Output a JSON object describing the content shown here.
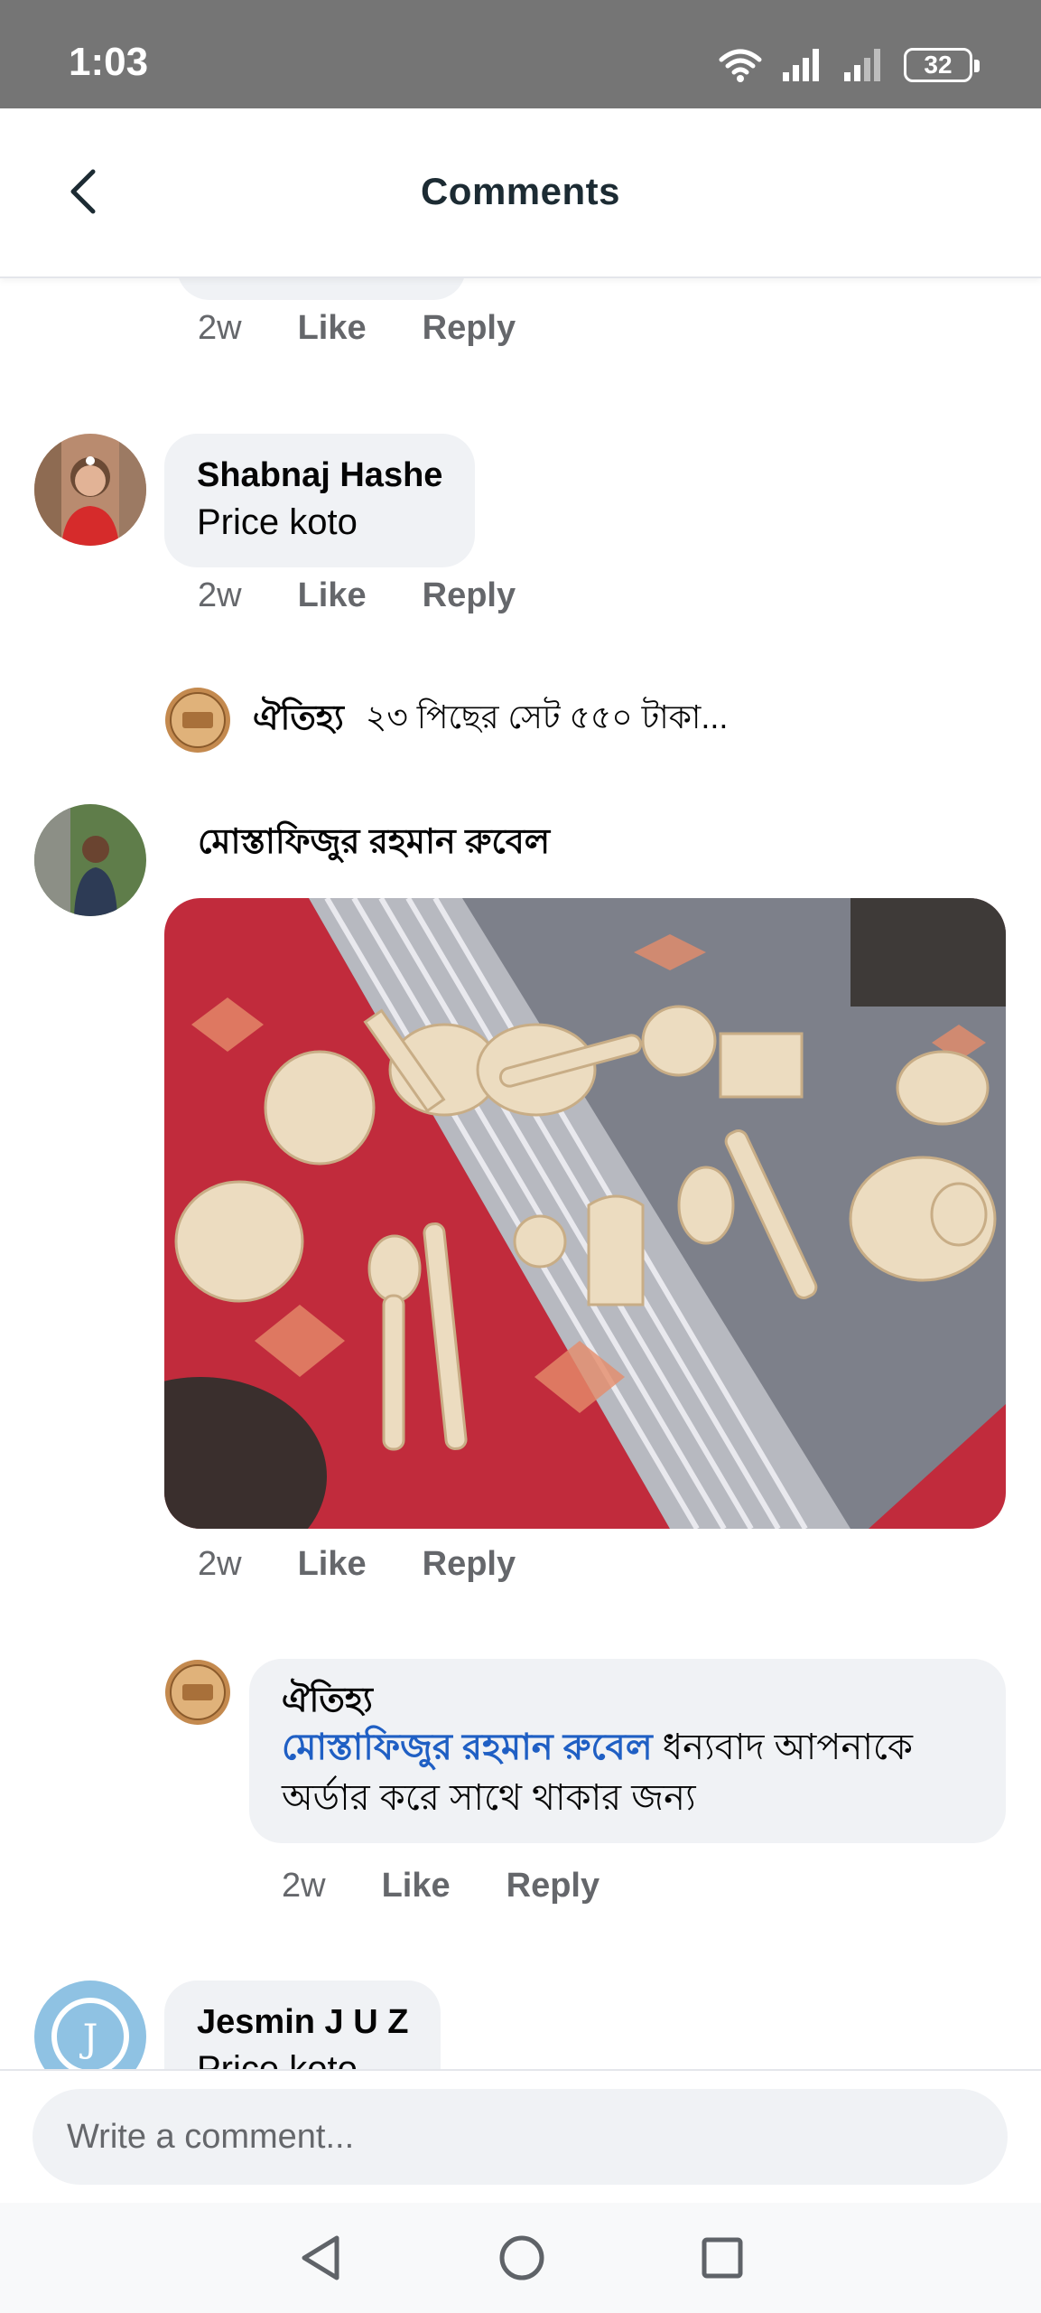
{
  "status_bar": {
    "time": "1:03",
    "battery": "32",
    "icons": [
      "wifi-icon",
      "signal-icon",
      "signal-weak-icon",
      "battery-icon"
    ]
  },
  "header": {
    "title": "Comments",
    "back_icon": "chevron-left-icon"
  },
  "comments": [
    {
      "author": "",
      "text": "",
      "time": "2w",
      "like_label": "Like",
      "reply_label": "Reply"
    },
    {
      "author": "Shabnaj Hashe",
      "text": "Price koto",
      "time": "2w",
      "like_label": "Like",
      "reply_label": "Reply",
      "reply_preview": {
        "author": "ঐতিহ্য",
        "text": "২৩ পিছের সেট ৫৫০ টাকা..."
      }
    },
    {
      "author": "মোস্তাফিজুর রহমান রুবেল",
      "image_desc": "wooden toy kitchen set",
      "time": "2w",
      "like_label": "Like",
      "reply_label": "Reply",
      "reply": {
        "author": "ঐতিহ্য",
        "mention": "মোস্তাফিজুর রহমান রুবেল",
        "text_line1": " ধন্যবাদ আপনাকে",
        "text_line2": "অর্ডার করে সাথে থাকার জন্য",
        "time": "2w",
        "like_label": "Like",
        "reply_label": "Reply"
      }
    },
    {
      "author": "Jesmin J U Z",
      "text": "Price koto"
    }
  ],
  "composer": {
    "placeholder": "Write a comment..."
  },
  "nav": {
    "icons": [
      "back-triangle-icon",
      "home-circle-icon",
      "recents-square-icon"
    ]
  },
  "colors": {
    "status_bar": "#757575",
    "bubble": "#f0f2f5",
    "mention": "#1f5fc4",
    "secondary_text": "#65676b"
  }
}
